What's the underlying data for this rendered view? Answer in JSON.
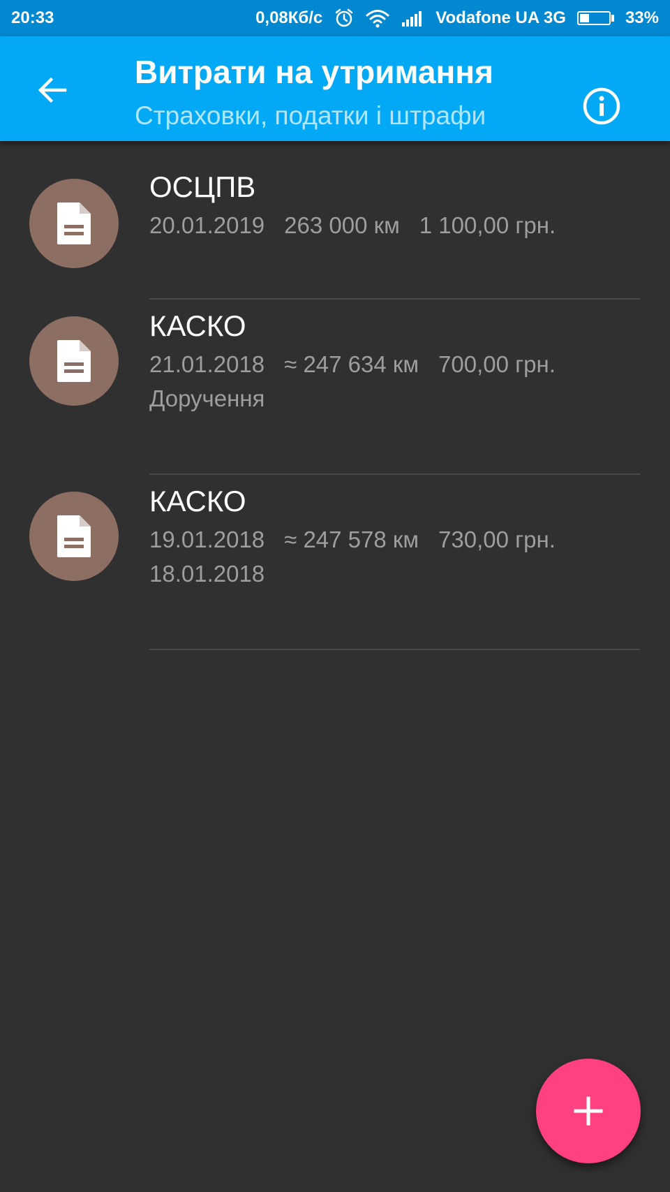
{
  "status_bar": {
    "time": "20:33",
    "net_speed": "0,08Кб/с",
    "carrier": "Vodafone UA 3G",
    "battery_percent": "33%",
    "battery_level": 0.33,
    "icons": [
      "alarm-icon",
      "wifi-icon",
      "signal-icon",
      "battery-icon"
    ]
  },
  "app_bar": {
    "title": "Витрати на утримання",
    "subtitle": "Страховки, податки і штрафи",
    "icons": [
      "back-arrow-icon",
      "info-icon"
    ]
  },
  "items": [
    {
      "title": "ОСЦПВ",
      "date": "20.01.2019",
      "mileage": "263 000 км",
      "amount": "1 100,00 грн.",
      "note": "",
      "icon": "document-icon"
    },
    {
      "title": "КАСКО",
      "date": "21.01.2018",
      "mileage": "≈ 247 634 км",
      "amount": "700,00 грн.",
      "note": "Доручення",
      "icon": "document-icon"
    },
    {
      "title": "КАСКО",
      "date": "19.01.2018",
      "mileage": "≈ 247 578 км",
      "amount": "730,00 грн.",
      "note": "18.01.2018",
      "icon": "document-icon"
    }
  ],
  "fab": {
    "icon": "plus-icon"
  },
  "colors": {
    "status_bar": "#0288d1",
    "app_bar": "#03a9f4",
    "subtitle": "#b3e5fc",
    "background": "#303030",
    "avatar": "#8d6e63",
    "fab": "#ff4081",
    "secondary_text": "#9e9e9e"
  }
}
